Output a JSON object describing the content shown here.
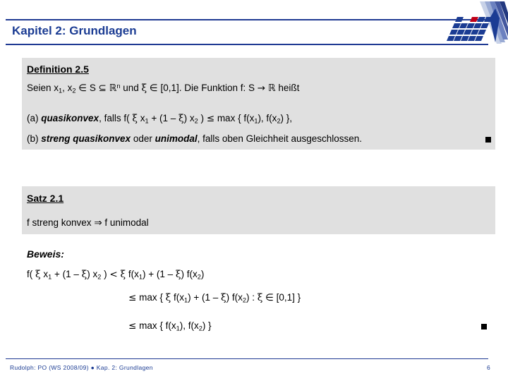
{
  "slide": {
    "title": "Kapitel 2: Grundlagen",
    "accent_color": "#1b3c93",
    "box_color": "#e0e0e0"
  },
  "definition": {
    "heading": "Definition 2.5",
    "intro_pre": "Seien x",
    "intro_1": "1",
    "intro_mid": ", x",
    "intro_2": "2",
    "intro_in": "∈",
    "intro_s": "S",
    "intro_subset": "⊆",
    "intro_rn": "ℝ",
    "intro_n": "n",
    "intro_und": "und",
    "intro_xi": "ξ",
    "intro_in2": "∈",
    "intro_interval": "[0,1]. Die Funktion f: S",
    "intro_arrow": "→",
    "intro_r": "ℝ",
    "intro_heisst": "heißt",
    "item_a": {
      "label": "(a)",
      "term": "quasikonvex",
      "rest_1": ", falls f(",
      "xi": "ξ",
      "rest_2": "x",
      "sub_1": "1",
      "rest_3": "+ (1 –",
      "xi2": "ξ",
      "rest_4": ") x",
      "sub_2": "2",
      "rest_5": ")",
      "leq": "≤",
      "rest_6": "max { f(x",
      "sub_3": "1",
      "rest_7": "), f(x",
      "sub_4": "2",
      "rest_8": ") },"
    },
    "item_b": {
      "label": "(b)",
      "term_1": "streng quasikonvex",
      "oder": "oder",
      "term_2": "unimodal",
      "rest": ", falls oben Gleichheit ausgeschlossen.",
      "qed": "■"
    }
  },
  "satz": {
    "heading": "Satz 2.1",
    "statement_1": "f streng konvex",
    "implies": "⇒",
    "statement_2": "f unimodal"
  },
  "beweis": {
    "heading": "Beweis:",
    "line1": {
      "pre": "f(",
      "xi": "ξ",
      "x1": "x",
      "s1": "1",
      "plus": "+ (1 –",
      "xi2": "ξ",
      "x2": ") x",
      "s2": "2",
      "close": ")",
      "lt": "<",
      "xi3": "ξ",
      "fx1": "f(x",
      "s3": "1",
      "plus2": ") + (1 –",
      "xi4": "ξ",
      "fx2": ") f(x",
      "s4": "2",
      "close2": ")"
    },
    "line2": {
      "leq": "≤",
      "max": "max {",
      "xi": "ξ",
      "fx1": "f(x",
      "s1": "1",
      "plus": ") + (1 –",
      "xi2": "ξ",
      "fx2": ") f(x",
      "s2": "2",
      "colon": ") :",
      "xi3": "ξ",
      "in": "∈",
      "interval": "[0,1] }"
    },
    "line3": {
      "leq": "≤",
      "max": "max { f(x",
      "s1": "1",
      "comma": "), f(x",
      "s2": "2",
      "close": ") }",
      "qed": "■"
    }
  },
  "footer": {
    "text": "Rudolph: PO (WS 2008/09)  ●  Kap. 2: Grundlagen",
    "page": "6"
  }
}
